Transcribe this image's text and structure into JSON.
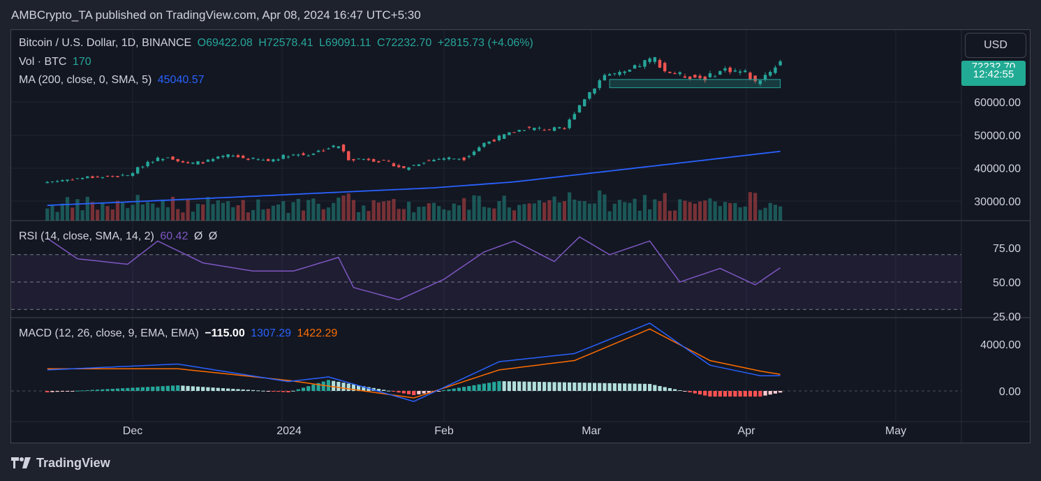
{
  "header": {
    "published": "AMBCrypto_TA published on TradingView.com, Apr 08, 2024 16:47 UTC+5:30"
  },
  "legend": {
    "symbol": "Bitcoin / U.S. Dollar, 1D, BINANCE",
    "open": "O69422.08",
    "high": "H72578.41",
    "low": "L69091.11",
    "close": "C72232.70",
    "change": "+2815.73 (+4.06%)",
    "vol_label": "Vol · BTC",
    "vol_value": "170",
    "ma_label": "MA (200, close, 0, SMA, 5)",
    "ma_value": "45040.57",
    "rsi_label": "RSI (14, close, SMA, 14, 2)",
    "rsi_value": "60.42",
    "rsi_extra1": "Ø",
    "rsi_extra2": "Ø",
    "macd_label": "MACD (12, 26, close, 9, EMA, EMA)",
    "macd_hist": "−115.00",
    "macd_line": "1307.29",
    "macd_signal": "1422.29"
  },
  "currency_button": "USD",
  "last_price_tag": {
    "price": "72232.70",
    "countdown": "12:42:55"
  },
  "footer": {
    "brand": "TradingView"
  },
  "colors": {
    "up": "#26a69a",
    "down": "#ef5350",
    "ma": "#2962ff",
    "rsi": "#7e57c2",
    "macd": "#2962ff",
    "signal": "#ff6d00",
    "price_tag": "#22ab94",
    "range_box": "#26a69a"
  },
  "chart_data": {
    "type": "candlestick",
    "price_axis": {
      "ticks": [
        "60000.00",
        "50000.00",
        "40000.00",
        "30000.00"
      ],
      "values": [
        60000,
        50000,
        40000,
        30000
      ]
    },
    "rsi_axis": {
      "ticks": [
        "75.00",
        "50.00",
        "25.00"
      ],
      "values": [
        75,
        50,
        25
      ],
      "bands": [
        70,
        50,
        30
      ]
    },
    "macd_axis": {
      "ticks": [
        "4000.00",
        "0.00"
      ],
      "values": [
        4000,
        0
      ]
    },
    "time_axis": {
      "labels": [
        "Dec",
        "2024",
        "Feb",
        "Mar",
        "Apr",
        "May"
      ]
    },
    "series": [
      {
        "name": "Bitcoin / U.S. Dollar",
        "x": [
          "2023-11-14",
          "2023-11-18",
          "2023-11-22",
          "2023-11-26",
          "2023-11-30",
          "2023-12-04",
          "2023-12-08",
          "2023-12-12",
          "2023-12-16",
          "2023-12-20",
          "2023-12-24",
          "2023-12-28",
          "2024-01-01",
          "2024-01-05",
          "2024-01-09",
          "2024-01-11",
          "2024-01-13",
          "2024-01-17",
          "2024-01-21",
          "2024-01-24",
          "2024-01-28",
          "2024-02-01",
          "2024-02-05",
          "2024-02-09",
          "2024-02-13",
          "2024-02-17",
          "2024-02-21",
          "2024-02-25",
          "2024-02-27",
          "2024-02-29",
          "2024-03-04",
          "2024-03-08",
          "2024-03-12",
          "2024-03-14",
          "2024-03-16",
          "2024-03-20",
          "2024-03-24",
          "2024-03-28",
          "2024-04-01",
          "2024-04-03",
          "2024-04-06",
          "2024-04-08"
        ],
        "close": [
          35800,
          36500,
          37200,
          37300,
          37700,
          41900,
          43600,
          41200,
          42100,
          43800,
          42800,
          42200,
          44000,
          44100,
          46100,
          46700,
          42800,
          42700,
          41600,
          39800,
          42000,
          43000,
          42900,
          47500,
          49800,
          52000,
          51800,
          51700,
          57000,
          61200,
          68300,
          68500,
          72100,
          73100,
          69400,
          67800,
          67200,
          69900,
          68900,
          65900,
          69400,
          72232
        ]
      },
      {
        "name": "MA (200, close, 0, SMA, 5)",
        "x": [
          "2023-11-14",
          "2023-12-01",
          "2023-12-20",
          "2024-01-10",
          "2024-01-30",
          "2024-02-15",
          "2024-03-01",
          "2024-03-20",
          "2024-04-08"
        ],
        "values": [
          28700,
          29800,
          31100,
          32600,
          34000,
          35800,
          38400,
          41700,
          45040
        ]
      },
      {
        "name": "RSI (14, close, SMA, 14, 2)",
        "x": [
          "2023-11-14",
          "2023-11-20",
          "2023-11-30",
          "2023-12-06",
          "2023-12-15",
          "2023-12-25",
          "2024-01-02",
          "2024-01-11",
          "2024-01-14",
          "2024-01-23",
          "2024-02-01",
          "2024-02-09",
          "2024-02-15",
          "2024-02-23",
          "2024-02-28",
          "2024-03-05",
          "2024-03-13",
          "2024-03-19",
          "2024-03-27",
          "2024-04-03",
          "2024-04-08"
        ],
        "values": [
          82,
          67,
          63,
          80,
          64,
          58,
          58,
          68,
          46,
          37,
          52,
          72,
          80,
          65,
          83,
          70,
          80,
          50,
          60,
          48,
          60.42
        ]
      },
      {
        "name": "MACD",
        "x": [
          "2023-11-14",
          "2023-12-10",
          "2024-01-01",
          "2024-01-09",
          "2024-01-26",
          "2024-02-12",
          "2024-02-27",
          "2024-03-13",
          "2024-03-25",
          "2024-04-04",
          "2024-04-08"
        ],
        "values": [
          1800,
          2300,
          800,
          1200,
          -900,
          2500,
          3200,
          5800,
          2200,
          1300,
          1307.29
        ]
      },
      {
        "name": "Signal",
        "x": [
          "2023-11-14",
          "2023-12-10",
          "2024-01-01",
          "2024-01-26",
          "2024-02-12",
          "2024-02-27",
          "2024-03-13",
          "2024-03-25",
          "2024-04-04",
          "2024-04-08"
        ],
        "values": [
          1900,
          1900,
          900,
          -600,
          1800,
          2600,
          5300,
          2600,
          1700,
          1422.29
        ]
      }
    ]
  }
}
